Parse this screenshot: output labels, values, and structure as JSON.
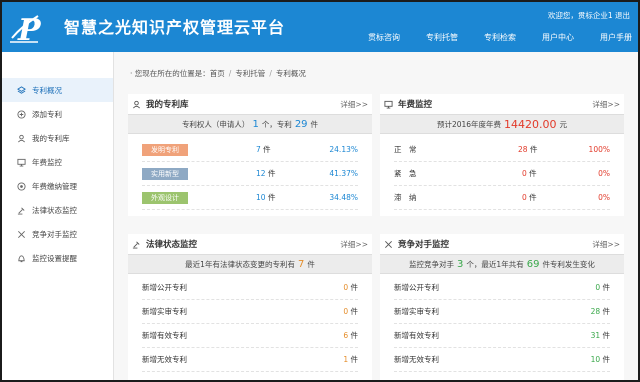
{
  "header": {
    "brand": "智慧之光知识产权管理云平台",
    "welcome": "欢迎您，贯标企业1 退出",
    "nav": [
      "贯标咨询",
      "专利托管",
      "专利检索",
      "用户中心",
      "用户手册"
    ]
  },
  "sidebar": {
    "items": [
      {
        "label": "专利概况",
        "icon": "layers-icon",
        "active": true
      },
      {
        "label": "添加专利",
        "icon": "plus-circle-icon"
      },
      {
        "label": "我的专利库",
        "icon": "user-icon"
      },
      {
        "label": "年费监控",
        "icon": "monitor-icon"
      },
      {
        "label": "年费缴纳管理",
        "icon": "gear-circle-icon"
      },
      {
        "label": "法律状态监控",
        "icon": "gavel-icon"
      },
      {
        "label": "竞争对手监控",
        "icon": "cross-icon"
      },
      {
        "label": "监控设置提醒",
        "icon": "bell-icon"
      }
    ]
  },
  "breadcrumb": {
    "prefix": "· 您现在所在的位置是：",
    "items": [
      "首页",
      "专利托管",
      "专利概况"
    ]
  },
  "mylib": {
    "title": "我的专利库",
    "more": "详细>>",
    "sum_a": "专利权人（申请人）",
    "owners": "1",
    "sum_b": "个，专利",
    "patents": "29",
    "sum_c": "件",
    "rows": [
      {
        "tag": "发明专利",
        "color": "#f0a27a",
        "count": "7",
        "unit": "件",
        "pct": "24.13%"
      },
      {
        "tag": "实用新型",
        "color": "#8ea9c4",
        "count": "12",
        "unit": "件",
        "pct": "41.37%"
      },
      {
        "tag": "外观设计",
        "color": "#9cc46e",
        "count": "10",
        "unit": "件",
        "pct": "34.48%"
      }
    ]
  },
  "fee": {
    "title": "年费监控",
    "more": "详细>>",
    "sum_a": "预计2016年度年费",
    "amount": "14420.00",
    "sum_b": "元",
    "rows": [
      {
        "label": "正　常",
        "count": "28",
        "unit": "件",
        "pct": "100%"
      },
      {
        "label": "紧　急",
        "count": "0",
        "unit": "件",
        "pct": "0%"
      },
      {
        "label": "滞　纳",
        "count": "0",
        "unit": "件",
        "pct": "0%"
      }
    ]
  },
  "legal": {
    "title": "法律状态监控",
    "more": "详细>>",
    "sum_a": "最近1年有法律状态变更的专利有",
    "num": "7",
    "sum_b": "件",
    "rows": [
      {
        "label": "新增公开专利",
        "count": "0",
        "unit": "件"
      },
      {
        "label": "新增实审专利",
        "count": "0",
        "unit": "件"
      },
      {
        "label": "新增有效专利",
        "count": "6",
        "unit": "件"
      },
      {
        "label": "新增无效专利",
        "count": "1",
        "unit": "件"
      }
    ]
  },
  "rival": {
    "title": "竞争对手监控",
    "more": "详细>>",
    "sum_a": "监控竞争对手",
    "num1": "3",
    "sum_b": "个，最近1年共有",
    "num2": "69",
    "sum_c": "件专利发生变化",
    "rows": [
      {
        "label": "新增公开专利",
        "count": "0",
        "unit": "件"
      },
      {
        "label": "新增实审专利",
        "count": "28",
        "unit": "件"
      },
      {
        "label": "新增有效专利",
        "count": "31",
        "unit": "件"
      },
      {
        "label": "新增无效专利",
        "count": "10",
        "unit": "件"
      }
    ]
  }
}
